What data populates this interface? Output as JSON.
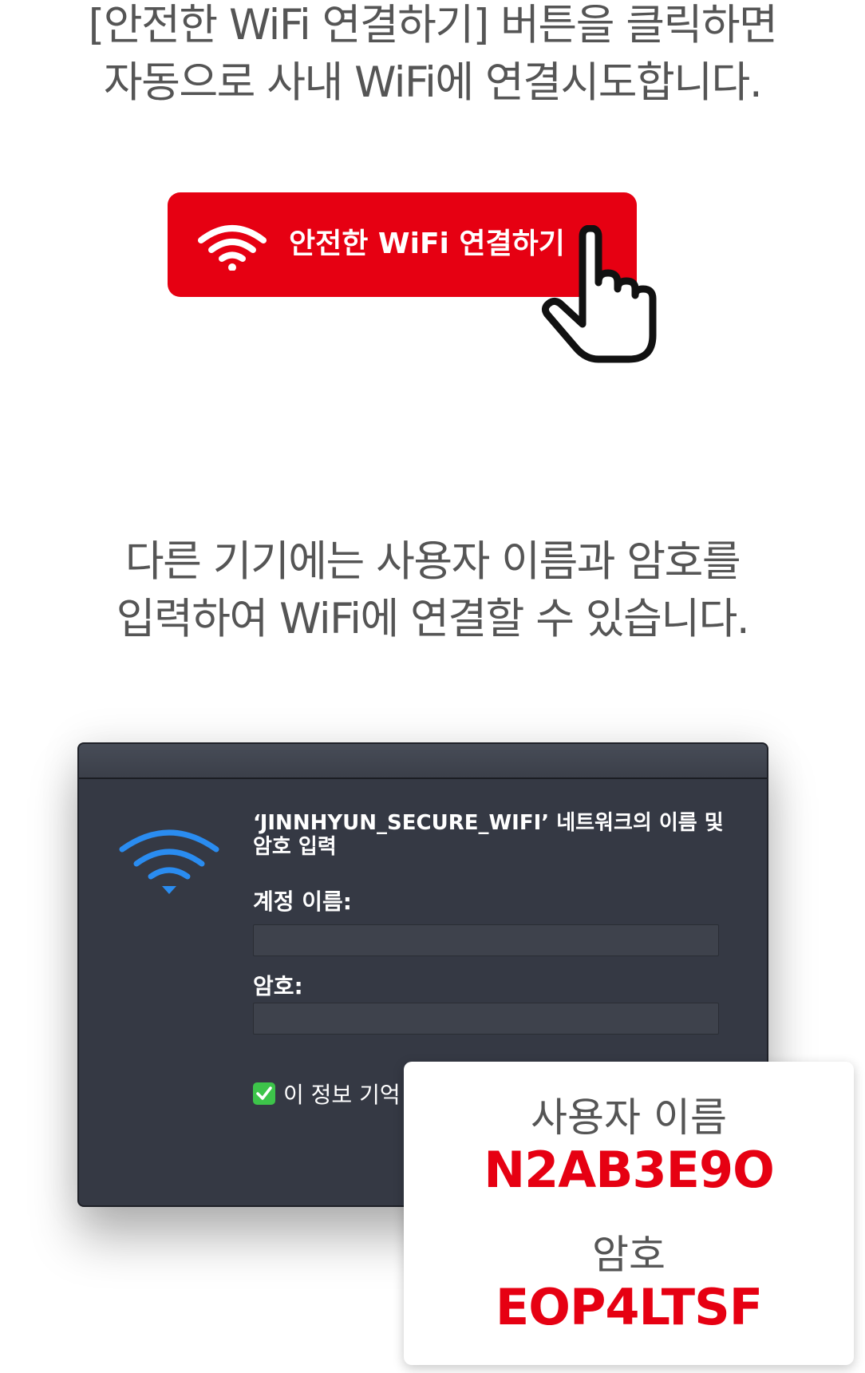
{
  "intro_top": {
    "line1": "[안전한 WiFi 연결하기] 버튼을 클릭하면",
    "line2": "자동으로 사내 WiFi에 연결시도합니다."
  },
  "connect_button": {
    "label": "안전한 WiFi 연결하기",
    "icon": "wifi-icon",
    "pointer_icon": "hand-pointer-icon"
  },
  "intro_mid": {
    "line1": "다른 기기에는 사용자 이름과 암호를",
    "line2": "입력하여 WiFi에 연결할 수 있습니다."
  },
  "dialog": {
    "title": "‘JINNHYUN_SECURE_WIFI’ 네트워크의 이름 및 암호 입력",
    "account_label": "계정 이름:",
    "account_value": "",
    "password_label": "암호:",
    "password_value": "",
    "remember_label": "이 정보 기억",
    "remember_checked": true,
    "icon": "wifi-icon"
  },
  "credentials": {
    "username_label": "사용자 이름",
    "username_value": "N2AB3E9O",
    "password_label": "암호",
    "password_value": "EOP4LTSF"
  },
  "colors": {
    "accent_red": "#e60012",
    "dialog_bg": "#353944",
    "wifi_blue": "#2a8cf0",
    "check_green": "#3dc44a"
  }
}
